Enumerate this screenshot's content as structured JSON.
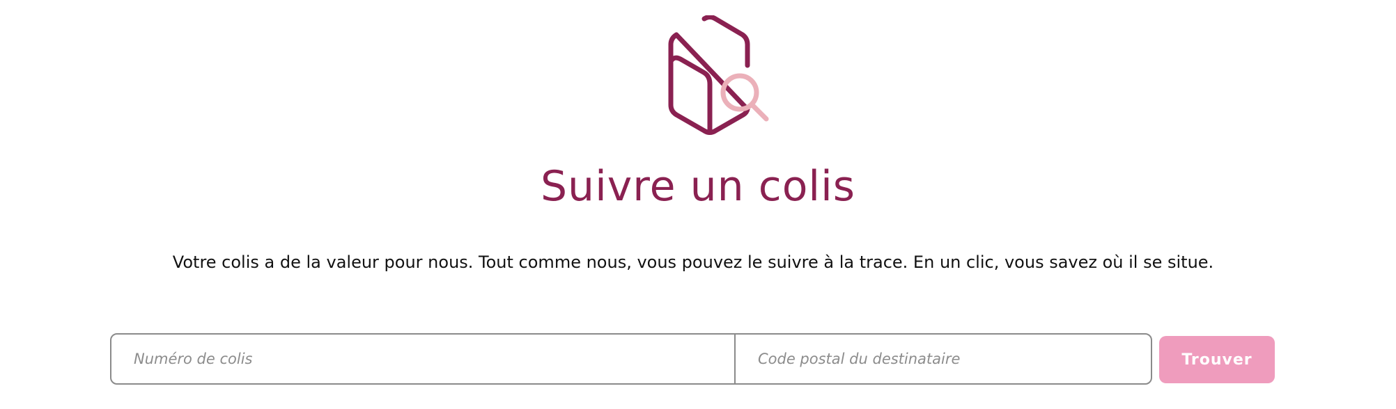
{
  "hero": {
    "icon": "package-search-icon",
    "title": "Suivre un colis",
    "description": "Votre colis a de la valeur pour nous. Tout comme nous, vous pouvez le suivre à la trace. En un clic, vous savez où il se situe."
  },
  "form": {
    "parcel_number": {
      "value": "",
      "placeholder": "Numéro de colis"
    },
    "postal_code": {
      "value": "",
      "placeholder": "Code postal du destinataire"
    },
    "submit_label": "Trouver"
  },
  "colors": {
    "brand": "#8a2151",
    "accent": "#ebb0b9",
    "button": "#ef9cbd",
    "border": "#8a8a8a"
  }
}
